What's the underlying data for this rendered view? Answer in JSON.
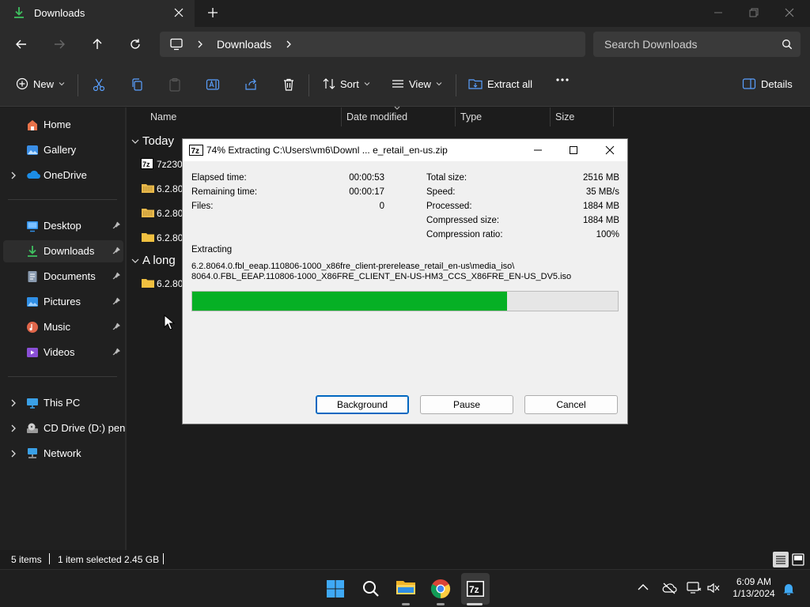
{
  "window": {
    "tab_title": "Downloads",
    "breadcrumb": "Downloads",
    "search_placeholder": "Search Downloads"
  },
  "toolbar": {
    "new_label": "New",
    "sort_label": "Sort",
    "view_label": "View",
    "extract_all_label": "Extract all",
    "details_label": "Details"
  },
  "sidebar": {
    "items": [
      {
        "label": "Home",
        "icon": "home-icon"
      },
      {
        "label": "Gallery",
        "icon": "gallery-icon"
      },
      {
        "label": "OneDrive",
        "icon": "onedrive-icon"
      },
      {
        "label": "Desktop",
        "icon": "desktop-icon"
      },
      {
        "label": "Downloads",
        "icon": "downloads-icon"
      },
      {
        "label": "Documents",
        "icon": "documents-icon"
      },
      {
        "label": "Pictures",
        "icon": "pictures-icon"
      },
      {
        "label": "Music",
        "icon": "music-icon"
      },
      {
        "label": "Videos",
        "icon": "videos-icon"
      },
      {
        "label": "This PC",
        "icon": "this-pc-icon"
      },
      {
        "label": "CD Drive (D:) penis",
        "icon": "cd-drive-icon"
      },
      {
        "label": "Network",
        "icon": "network-icon"
      }
    ]
  },
  "filelist": {
    "columns": [
      "Name",
      "Date modified",
      "Type",
      "Size"
    ],
    "groups": [
      "Today",
      "A long"
    ],
    "rows": [
      {
        "name": "7z230",
        "icon": "7zip-file-icon"
      },
      {
        "name": "6.2.80",
        "icon": "zip-folder-icon"
      },
      {
        "name": "6.2.80",
        "icon": "zip-folder-icon"
      },
      {
        "name": "6.2.80",
        "icon": "folder-icon"
      },
      {
        "name": "6.2.80",
        "icon": "folder-icon"
      }
    ]
  },
  "status": {
    "item_count": "5 items",
    "selection": "1 item selected  2.45 GB"
  },
  "taskbar": {
    "time": "6:09 AM",
    "date": "1/13/2024"
  },
  "dialog": {
    "title": "74% Extracting C:\\Users\\vm6\\Downl ... e_retail_en-us.zip",
    "app_icon_text": "7z",
    "left_stats": [
      {
        "label": "Elapsed time:",
        "value": "00:00:53"
      },
      {
        "label": "Remaining time:",
        "value": "00:00:17"
      },
      {
        "label": "Files:",
        "value": "0"
      }
    ],
    "right_stats": [
      {
        "label": "Total size:",
        "value": "2516 MB"
      },
      {
        "label": "Speed:",
        "value": "35 MB/s"
      },
      {
        "label": "Processed:",
        "value": "1884 MB"
      },
      {
        "label": "Compressed size:",
        "value": "1884 MB"
      },
      {
        "label": "Compression ratio:",
        "value": "100%"
      }
    ],
    "operation": "Extracting",
    "path_line1": "6.2.8064.0.fbl_eeap.110806-1000_x86fre_client-prerelease_retail_en-us\\media_iso\\",
    "path_line2": "8064.0.FBL_EEAP.110806-1000_X86FRE_CLIENT_EN-US-HM3_CCS_X86FRE_EN-US_DV5.iso",
    "progress_fraction": 0.74,
    "progress_color": "#06b025",
    "buttons": {
      "background": "Background",
      "pause": "Pause",
      "cancel": "Cancel"
    }
  },
  "colors": {
    "accent": "#0067c0",
    "folder": "#e8b84a"
  }
}
